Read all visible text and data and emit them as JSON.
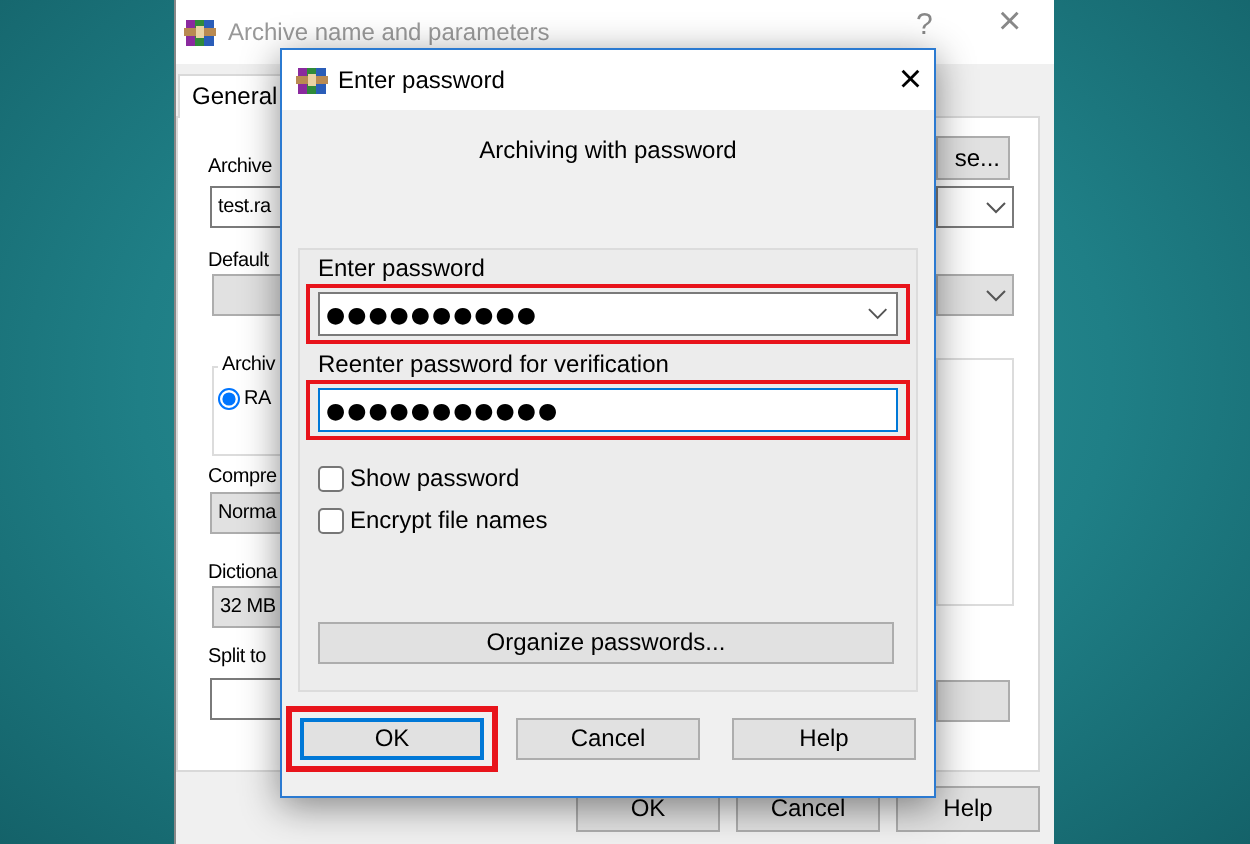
{
  "back_window": {
    "title": "Archive name and parameters",
    "help_glyph": "?",
    "close_glyph": "×",
    "tabs": [
      {
        "label": "General",
        "selected": true
      }
    ],
    "archive_name": {
      "label": "Archive",
      "value": "test.ra"
    },
    "browse_button": "se...",
    "default_profile": {
      "label": "Default"
    },
    "archive_format": {
      "group_label": "Archiv",
      "option": "RA",
      "selected": true
    },
    "compression": {
      "label": "Compre",
      "value": "Norma"
    },
    "dictionary": {
      "label": "Dictiona",
      "value": "32 MB"
    },
    "split": {
      "label": "Split to"
    },
    "buttons": [
      "OK",
      "Cancel",
      "Help"
    ]
  },
  "dialog": {
    "title": "Enter password",
    "close_glyph": "×",
    "heading": "Archiving with password",
    "password": {
      "label": "Enter password",
      "value": "●●●●●●●●●●",
      "highlighted": true
    },
    "reenter": {
      "label": "Reenter password for verification",
      "value": "●●●●●●●●●●●",
      "highlighted": true
    },
    "options": [
      {
        "label": "Show password",
        "checked": false
      },
      {
        "label": "Encrypt file names",
        "checked": false
      }
    ],
    "organize_button": "Organize passwords...",
    "buttons": [
      {
        "label": "OK",
        "default": true,
        "highlighted": true
      },
      {
        "label": "Cancel",
        "default": false,
        "highlighted": false
      },
      {
        "label": "Help",
        "default": false,
        "highlighted": false
      }
    ]
  }
}
